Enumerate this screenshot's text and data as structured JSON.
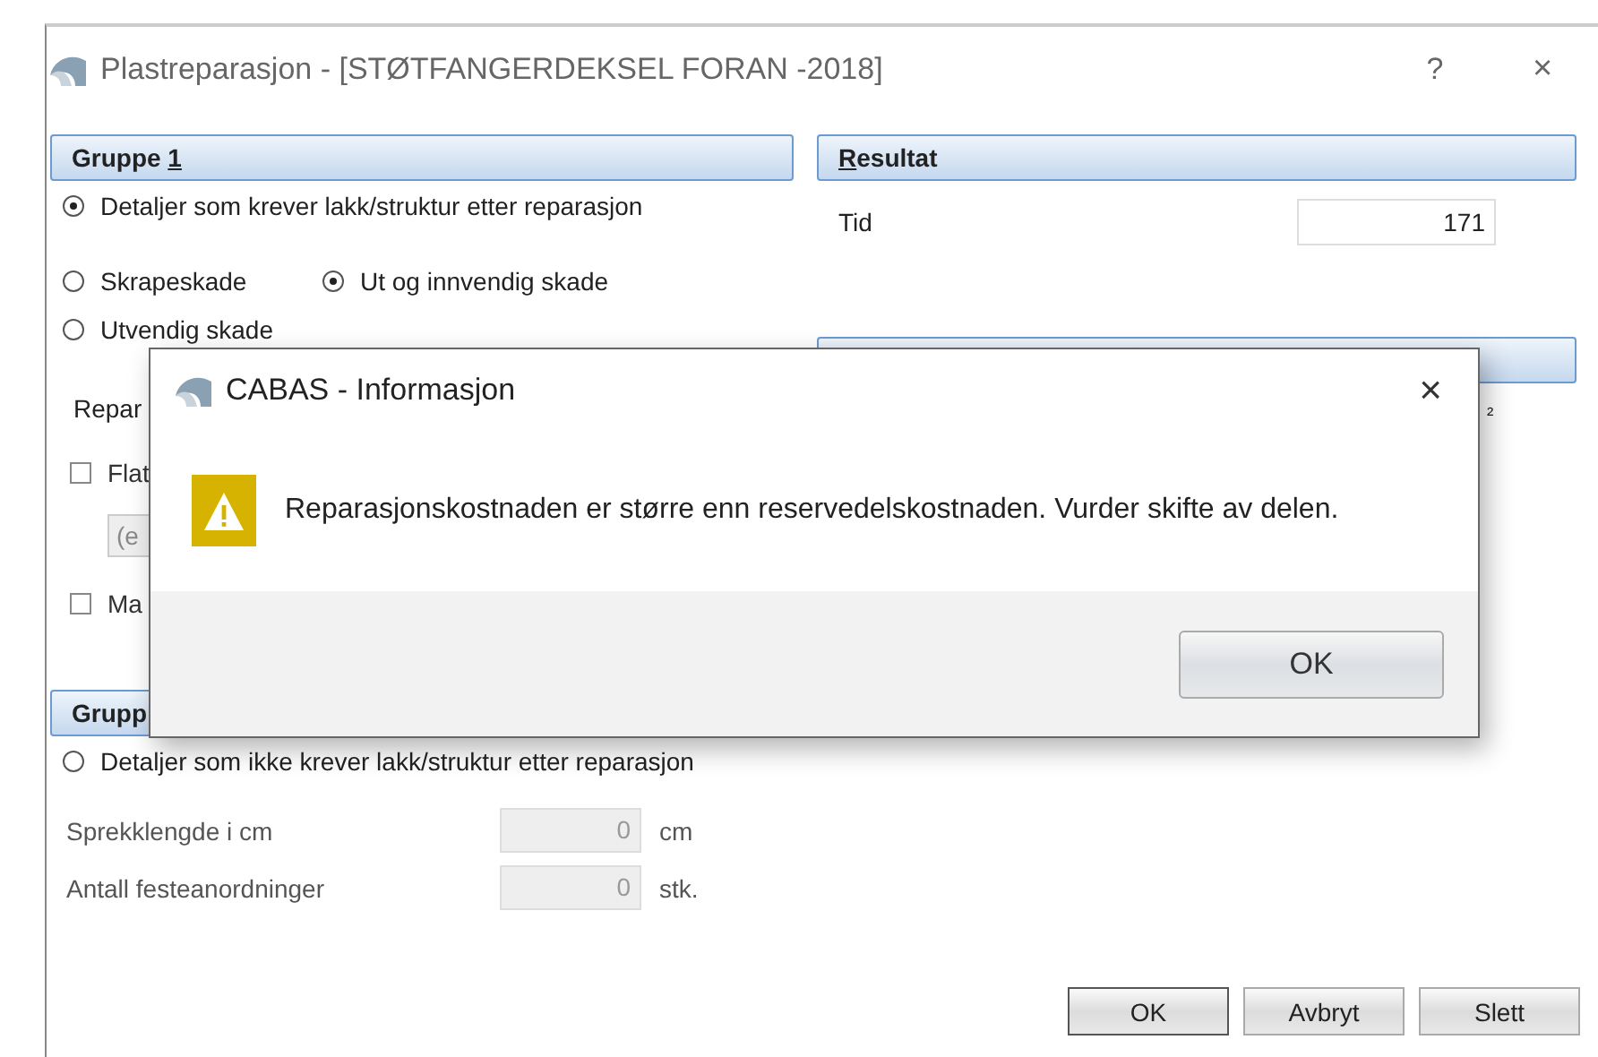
{
  "window": {
    "title": "Plastreparasjon - [STØTFANGERDEKSEL FORAN -2018]",
    "help": "?",
    "close": "×"
  },
  "group1": {
    "title": [
      {
        "text": "Gruppe ",
        "underline": false
      },
      {
        "text": "1",
        "underline": true
      }
    ],
    "main_option": {
      "label": "Detaljer som krever lakk/struktur etter reparasjon",
      "selected": true
    },
    "damage_options": [
      {
        "label": "Skrapeskade",
        "selected": false
      },
      {
        "label": "Ut og innvendig skade",
        "selected": true
      },
      {
        "label": "Utvendig skade",
        "selected": false
      }
    ],
    "repair_label": "Repar",
    "items": [
      {
        "kind": "checkbox",
        "label": "Flat",
        "checked": false
      },
      {
        "kind": "field",
        "placeholder": "(e"
      },
      {
        "kind": "checkbox",
        "label": "Ma",
        "checked": false
      }
    ]
  },
  "group2": {
    "title": [
      {
        "text": "Grupp",
        "underline": false
      }
    ],
    "main_option": {
      "label": "Detaljer som ikke krever lakk/struktur etter reparasjon",
      "selected": false
    },
    "fields": [
      {
        "label": "Sprekklengde i cm",
        "value": "0",
        "unit": "cm",
        "disabled": true
      },
      {
        "label": "Antall festeanordninger",
        "value": "0",
        "unit": "stk.",
        "disabled": true
      }
    ]
  },
  "result": {
    "title": [
      {
        "text": "R",
        "underline": true
      },
      {
        "text": "esultat",
        "underline": false
      }
    ],
    "time_label": "Tid",
    "time_value": "171",
    "unit_fragment": "²"
  },
  "dialog": {
    "title": "CABAS - Informasjon",
    "close": "×",
    "message": "Reparasjonskostnaden er større enn reservedelskostnaden. Vurder skifte av delen.",
    "button": "OK"
  },
  "buttons": [
    "OK",
    "Avbryt",
    "Slett"
  ]
}
